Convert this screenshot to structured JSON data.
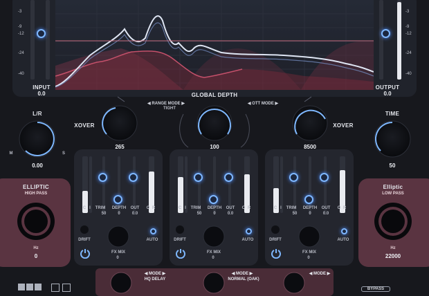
{
  "input_meter": {
    "label": "INPUT",
    "value": "0.0",
    "scale": [
      "-3",
      "-9",
      "-12",
      "-24",
      "-40"
    ]
  },
  "output_meter": {
    "label": "OUTPUT",
    "value": "0.0",
    "scale": [
      "-3",
      "-9",
      "-12",
      "-24",
      "-40"
    ]
  },
  "global_depth_label": "GLOBAL DEPTH",
  "range_mode": {
    "label": "RANGE MODE",
    "value": "TIGHT"
  },
  "ott_mode": {
    "label": "OTT MODE"
  },
  "lr": {
    "label": "L/R",
    "left": "M",
    "right": "S",
    "value": "0.00"
  },
  "time": {
    "label": "TIME",
    "value": "50"
  },
  "xover_low": {
    "label": "XOVER",
    "value": "265"
  },
  "center_knob": {
    "value": "100"
  },
  "xover_high": {
    "label": "XOVER",
    "value": "8500"
  },
  "high_pass": {
    "title": "ELLIPTIC",
    "subtitle": "HIGH PASS",
    "unit": "Hz",
    "value": "0"
  },
  "low_pass": {
    "title": "Elliptic",
    "subtitle": "LOW PASS",
    "unit": "Hz",
    "value": "22000"
  },
  "bands": [
    {
      "c_label": "C",
      "i_label": "I",
      "trim_label": "TRIM",
      "trim_value": "50",
      "depth_label": "DEPTH",
      "depth_value": "0",
      "out_label": "OUT",
      "out_value": "0.0",
      "o_label": "O",
      "r_label": "R",
      "drift_label": "DRIFT",
      "fx_label": "FX MIX",
      "fx_value": "0",
      "auto_label": "AUTO"
    },
    {
      "c_label": "C",
      "i_label": "I",
      "trim_label": "TRIM",
      "trim_value": "50",
      "depth_label": "DEPTH",
      "depth_value": "0",
      "out_label": "OUT",
      "out_value": "0.0",
      "o_label": "O",
      "r_label": "R",
      "drift_label": "DRIFT",
      "fx_label": "FX MIX",
      "fx_value": "0",
      "auto_label": "AUTO"
    },
    {
      "c_label": "C",
      "i_label": "I",
      "trim_label": "TRIM",
      "trim_value": "50",
      "depth_label": "DEPTH",
      "depth_value": "0",
      "out_label": "OUT",
      "out_value": "0.0",
      "o_label": "O",
      "r_label": "R",
      "drift_label": "DRIFT",
      "fx_label": "FX MIX",
      "fx_value": "0",
      "auto_label": "AUTO"
    }
  ],
  "bottom_modes": [
    {
      "label": "MODE",
      "value": "HQ DELAY"
    },
    {
      "label": "MODE",
      "value": "NORMAL (OAK)"
    },
    {
      "label": "MODE",
      "value": ""
    }
  ],
  "bypass_label": "BYPASS",
  "colors": {
    "accent_blue": "#7fb8ff",
    "panel_pink": "#5a3441",
    "background": "#17181d"
  }
}
